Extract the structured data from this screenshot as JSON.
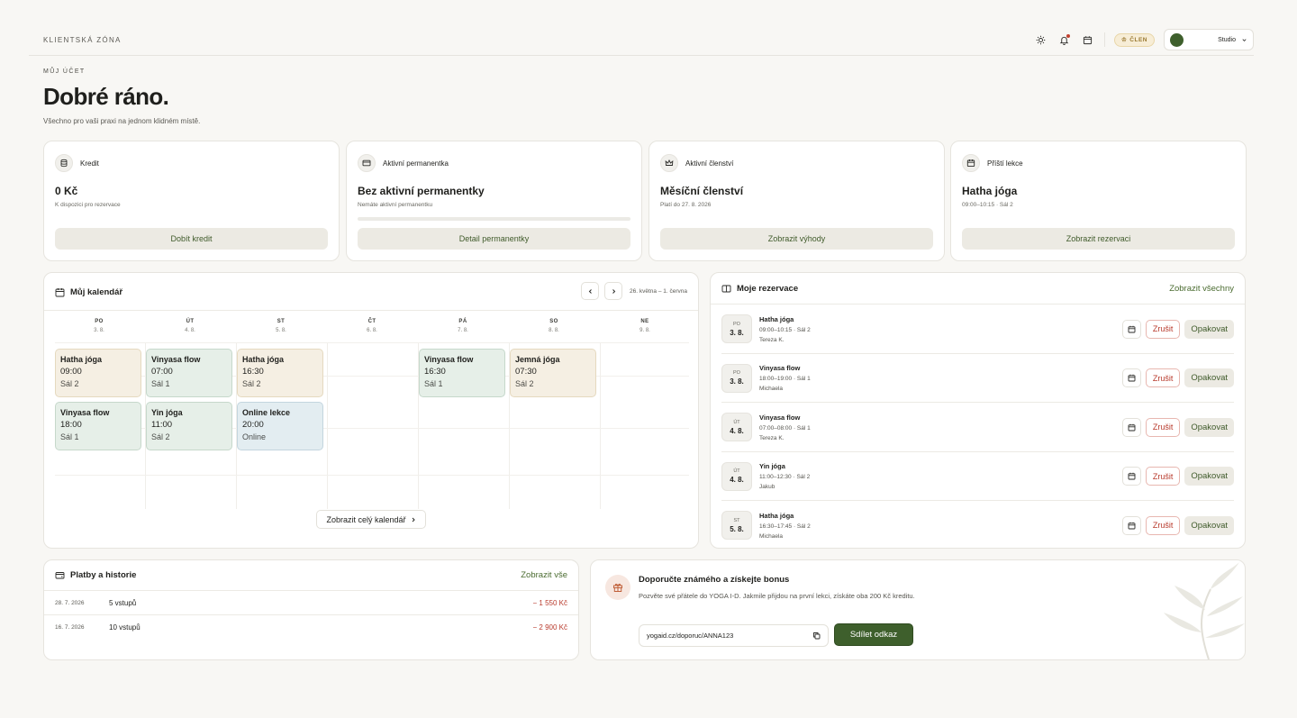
{
  "topbar": {
    "zone_label": "KLIENTSKÁ ZÓNA",
    "member_badge": "ČLEN",
    "studio_name": "Studio",
    "icons": [
      "sun-icon",
      "bell-icon",
      "calendar-icon"
    ]
  },
  "header": {
    "eyebrow": "MŮJ ÚČET",
    "greeting": "Dobré ráno.",
    "subtitle": "Všechno pro vaši praxi na jednom klidném místě."
  },
  "stats": [
    {
      "label": "Kredit",
      "value": "0 Kč",
      "sub": "K dispozici pro rezervace",
      "button": "Dobít kredit",
      "icon": "coins-icon"
    },
    {
      "label": "Aktivní permanentka",
      "value": "Bez aktivní permanentky",
      "sub": "Nemáte aktivní permanentku",
      "button": "Detail permanentky",
      "icon": "card-icon",
      "progress": 0
    },
    {
      "label": "Aktivní členství",
      "value": "Měsíční členství",
      "sub": "Platí do 27. 8. 2026",
      "button": "Zobrazit výhody",
      "icon": "crown-icon"
    },
    {
      "label": "Příští lekce",
      "value": "Hatha jóga",
      "sub": "09:00–10:15 · Sál 2",
      "button": "Zobrazit rezervaci",
      "icon": "calendar-icon"
    }
  ],
  "calendar": {
    "title": "Můj kalendář",
    "range": "26. května – 1. června",
    "full_button": "Zobrazit celý kalendář",
    "days": [
      {
        "name": "PO",
        "date": "3. 8."
      },
      {
        "name": "ÚT",
        "date": "4. 8."
      },
      {
        "name": "ST",
        "date": "5. 8."
      },
      {
        "name": "ČT",
        "date": "6. 8."
      },
      {
        "name": "PÁ",
        "date": "7. 8."
      },
      {
        "name": "SO",
        "date": "8. 8."
      },
      {
        "name": "NE",
        "date": "9. 8."
      }
    ],
    "events": [
      {
        "title": "Hatha jóga",
        "time": "09:00",
        "room": "Sál 2",
        "color": "beige",
        "day": 0,
        "row": 0
      },
      {
        "title": "Vinyasa flow",
        "time": "07:00",
        "room": "Sál 1",
        "color": "green",
        "day": 1,
        "row": 0
      },
      {
        "title": "Hatha jóga",
        "time": "16:30",
        "room": "Sál 2",
        "color": "beige",
        "day": 2,
        "row": 0
      },
      {
        "title": "Vinyasa flow",
        "time": "16:30",
        "room": "Sál 1",
        "color": "green",
        "day": 4,
        "row": 0
      },
      {
        "title": "Jemná jóga",
        "time": "07:30",
        "room": "Sál 2",
        "color": "beige",
        "day": 5,
        "row": 0
      },
      {
        "title": "Vinyasa flow",
        "time": "18:00",
        "room": "Sál 1",
        "color": "green",
        "day": 0,
        "row": 1
      },
      {
        "title": "Yin jóga",
        "time": "11:00",
        "room": "Sál 2",
        "color": "green",
        "day": 1,
        "row": 1
      },
      {
        "title": "Online lekce",
        "time": "20:00",
        "room": "Online",
        "color": "blue",
        "day": 2,
        "row": 1
      }
    ]
  },
  "reservations": {
    "title": "Moje rezervace",
    "view_all": "Zobrazit všechny",
    "cancel_label": "Zrušit",
    "repeat_label": "Opakovat",
    "items": [
      {
        "day": "PO",
        "date": "3. 8.",
        "title": "Hatha jóga",
        "time": "09:00–10:15 · Sál 2",
        "coach": "Tereza K."
      },
      {
        "day": "PO",
        "date": "3. 8.",
        "title": "Vinyasa flow",
        "time": "18:00–19:00 · Sál 1",
        "coach": "Michaela"
      },
      {
        "day": "ÚT",
        "date": "4. 8.",
        "title": "Vinyasa flow",
        "time": "07:00–08:00 · Sál 1",
        "coach": "Tereza K."
      },
      {
        "day": "ÚT",
        "date": "4. 8.",
        "title": "Yin jóga",
        "time": "11:00–12:30 · Sál 2",
        "coach": "Jakub"
      },
      {
        "day": "ST",
        "date": "5. 8.",
        "title": "Hatha jóga",
        "time": "16:30–17:45 · Sál 2",
        "coach": "Michaela"
      }
    ]
  },
  "payments": {
    "title": "Platby a historie",
    "view_all": "Zobrazit vše",
    "rows": [
      {
        "date": "28. 7. 2026",
        "desc": "5 vstupů",
        "amount": "− 1 550 Kč"
      },
      {
        "date": "16. 7. 2026",
        "desc": "10 vstupů",
        "amount": "− 2 900 Kč"
      }
    ]
  },
  "referral": {
    "title": "Doporučte známého a získejte bonus",
    "text": "Pozvěte své přátele do YOGA I-D. Jakmile přijdou na první lekci, získáte oba 200 Kč kreditu.",
    "link": "yogaid.cz/doporuc/ANNA123",
    "share_button": "Sdílet odkaz"
  },
  "colors": {
    "accent": "#3e5f2c",
    "danger": "#b83a2c",
    "background": "#f8f7f4",
    "member_badge": "#f7edd6"
  }
}
